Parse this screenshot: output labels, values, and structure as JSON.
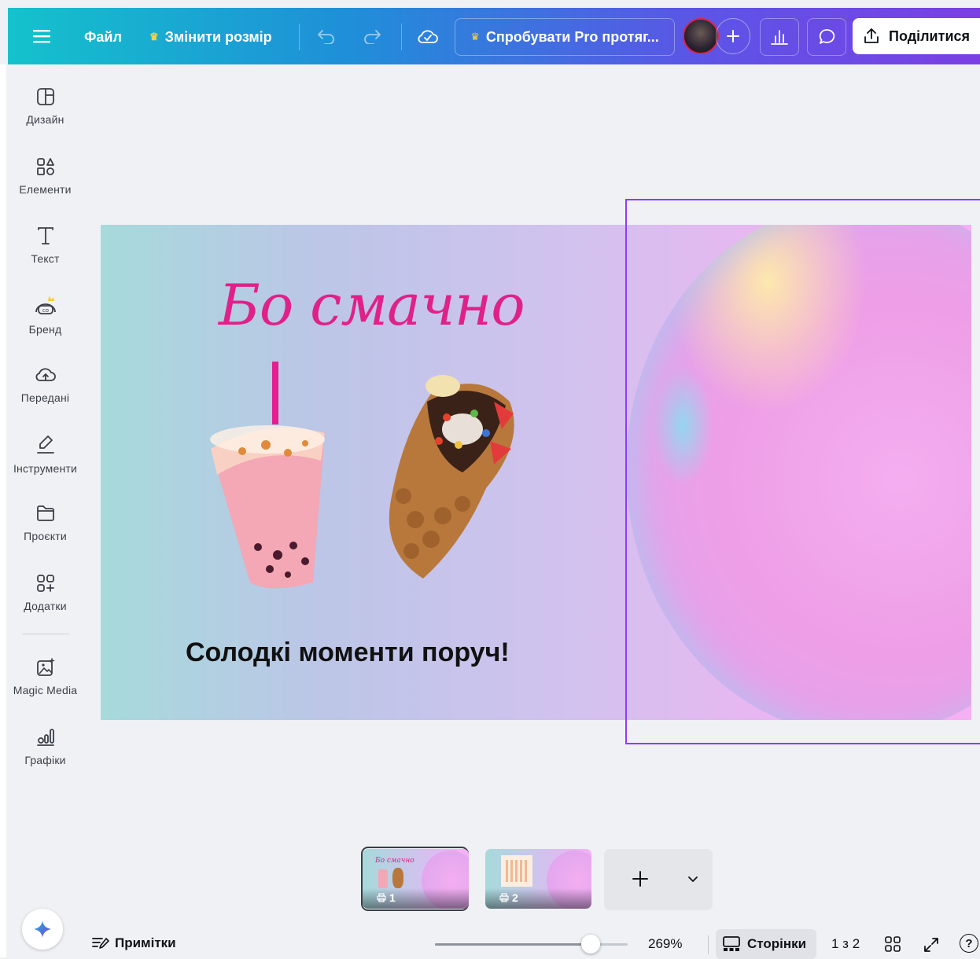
{
  "topbar": {
    "file_label": "Файл",
    "resize_label": "Змінити розмір",
    "try_pro_label": "Спробувати Pro протяг...",
    "share_label": "Поділитися"
  },
  "sidebar": {
    "items": [
      {
        "label": "Дизайн",
        "icon": "design-icon"
      },
      {
        "label": "Елементи",
        "icon": "elements-icon"
      },
      {
        "label": "Текст",
        "icon": "text-icon"
      },
      {
        "label": "Бренд",
        "icon": "brand-icon"
      },
      {
        "label": "Передані",
        "icon": "uploads-icon"
      },
      {
        "label": "Інструменти",
        "icon": "tools-icon"
      },
      {
        "label": "Проєкти",
        "icon": "projects-icon"
      },
      {
        "label": "Додатки",
        "icon": "apps-icon"
      },
      {
        "label": "Magic Media",
        "icon": "magic-media-icon"
      },
      {
        "label": "Графіки",
        "icon": "charts-icon"
      }
    ]
  },
  "canvas": {
    "headline": "Бо смачно",
    "tagline": "Солодкі моменти поруч!",
    "background_colors": [
      "#a6dadb",
      "#f6b0f4"
    ],
    "headline_color": "#e0218a"
  },
  "pages": {
    "thumbnails": [
      {
        "number": "1"
      },
      {
        "number": "2"
      }
    ],
    "add_label": "+"
  },
  "bottom": {
    "notes_label": "Примітки",
    "zoom": "269%",
    "pages_label": "Сторінки",
    "page_counter": "1 з 2",
    "help_label": "?"
  },
  "colors": {
    "accent": "#8b3dff",
    "topbar_start": "#14c2cc",
    "topbar_end": "#7b3fe4",
    "crown": "#ffd23d"
  }
}
